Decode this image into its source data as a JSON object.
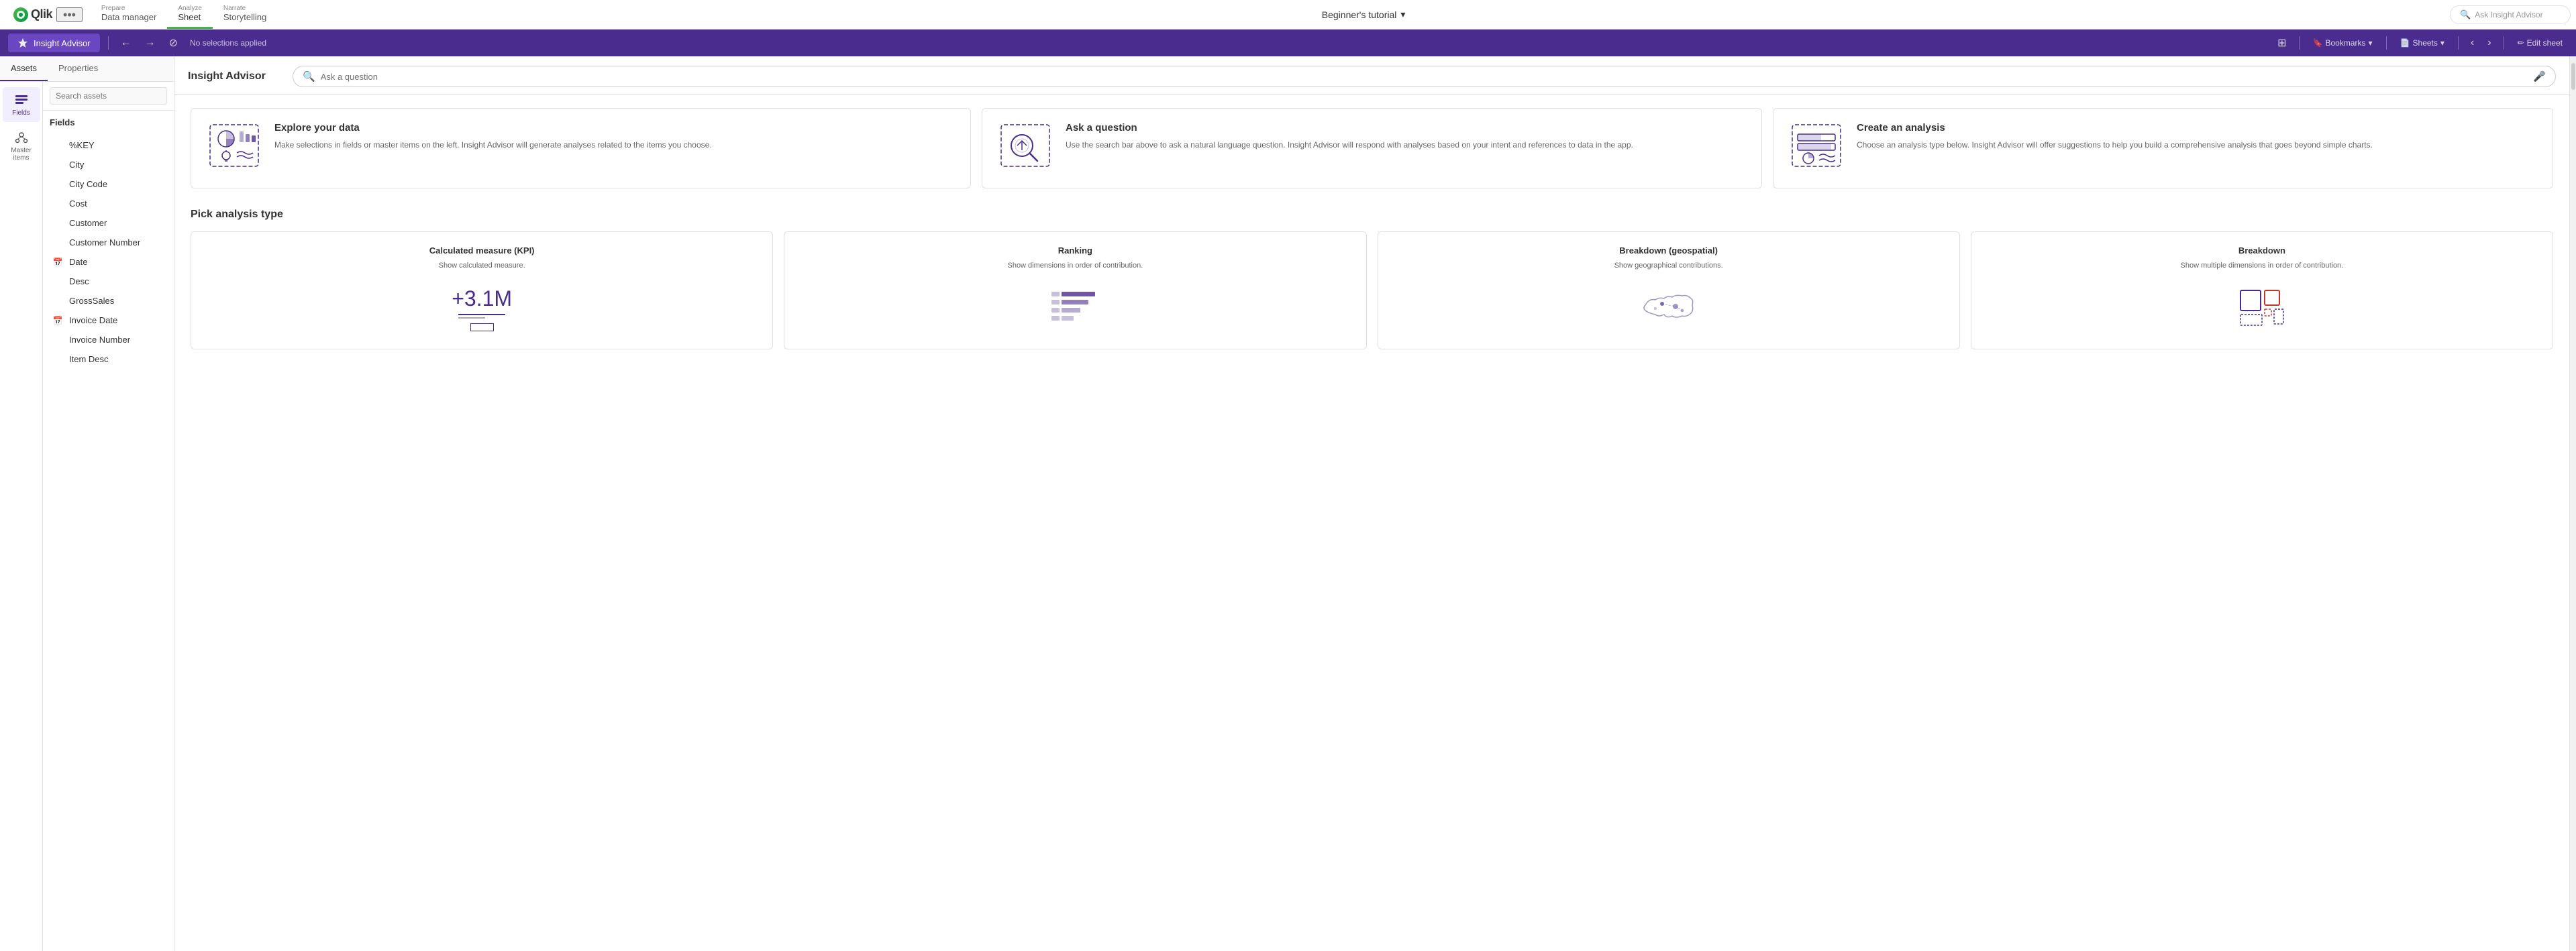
{
  "topNav": {
    "logo": "Qlik",
    "logoIcon": "●",
    "dotsLabel": "•••",
    "tabs": [
      {
        "id": "prepare",
        "label": "Prepare",
        "subtitle": "Data manager",
        "active": false
      },
      {
        "id": "analyze",
        "label": "Analyze",
        "subtitle": "Sheet",
        "active": true
      },
      {
        "id": "narrate",
        "label": "Narrate",
        "subtitle": "Storytelling",
        "active": false
      }
    ],
    "centerTitle": "Beginner's tutorial",
    "centerIcon": "▾",
    "askInsightPlaceholder": "Ask Insight Advisor",
    "searchIcon": "🔍"
  },
  "toolbar": {
    "insightAdvisorLabel": "Insight Advisor",
    "insightAdvisorIcon": "⬟",
    "noSelections": "No selections applied",
    "gridIcon": "⊞",
    "bookmarksLabel": "Bookmarks",
    "bookmarksIcon": "▾",
    "sheetsLabel": "Sheets",
    "sheetsIcon": "▾",
    "prevIcon": "‹",
    "nextIcon": "›",
    "editSheetLabel": "Edit sheet",
    "editIcon": "✏"
  },
  "leftPanel": {
    "tabs": [
      {
        "id": "assets",
        "label": "Assets",
        "active": true
      },
      {
        "id": "properties",
        "label": "Properties",
        "active": false
      }
    ],
    "assetIcons": [
      {
        "id": "fields",
        "icon": "≡",
        "label": "Fields",
        "active": true
      },
      {
        "id": "masteritems",
        "icon": "⬡",
        "label": "Master items",
        "active": false
      }
    ],
    "searchPlaceholder": "Search assets",
    "fieldsTitle": "Fields",
    "fields": [
      {
        "id": "key",
        "label": "%KEY",
        "icon": null
      },
      {
        "id": "city",
        "label": "City",
        "icon": null
      },
      {
        "id": "citycode",
        "label": "City Code",
        "icon": null
      },
      {
        "id": "cost",
        "label": "Cost",
        "icon": null
      },
      {
        "id": "customer",
        "label": "Customer",
        "icon": null
      },
      {
        "id": "customernumber",
        "label": "Customer Number",
        "icon": null
      },
      {
        "id": "date",
        "label": "Date",
        "icon": "📅"
      },
      {
        "id": "desc",
        "label": "Desc",
        "icon": null
      },
      {
        "id": "grosssales",
        "label": "GrossSales",
        "icon": null
      },
      {
        "id": "invoicedate",
        "label": "Invoice Date",
        "icon": "📅"
      },
      {
        "id": "invoicenumber",
        "label": "Invoice Number",
        "icon": null
      },
      {
        "id": "itemdesc",
        "label": "Item Desc",
        "icon": null
      }
    ]
  },
  "insightAdvisor": {
    "title": "Insight Advisor",
    "searchPlaceholder": "Ask a question",
    "infoCards": [
      {
        "id": "explore",
        "title": "Explore your data",
        "description": "Make selections in fields or master items on the left. Insight Advisor will generate analyses related to the items you choose.",
        "iconType": "explore"
      },
      {
        "id": "ask",
        "title": "Ask a question",
        "description": "Use the search bar above to ask a natural language question. Insight Advisor will respond with analyses based on your intent and references to data in the app.",
        "iconType": "ask"
      },
      {
        "id": "create",
        "title": "Create an analysis",
        "description": "Choose an analysis type below. Insight Advisor will offer suggestions to help you build a comprehensive analysis that goes beyond simple charts.",
        "iconType": "create"
      }
    ],
    "analysisSection": {
      "title": "Pick analysis type",
      "cards": [
        {
          "id": "kpi",
          "title": "Calculated measure (KPI)",
          "description": "Show calculated measure.",
          "visualType": "kpi",
          "value": "+3.1M"
        },
        {
          "id": "ranking",
          "title": "Ranking",
          "description": "Show dimensions in order of contribution.",
          "visualType": "ranking"
        },
        {
          "id": "geo",
          "title": "Breakdown (geospatial)",
          "description": "Show geographical contributions.",
          "visualType": "geo"
        },
        {
          "id": "breakdown",
          "title": "Breakdown",
          "description": "Show multiple dimensions in order of contribution.",
          "visualType": "breakdown"
        }
      ]
    }
  }
}
